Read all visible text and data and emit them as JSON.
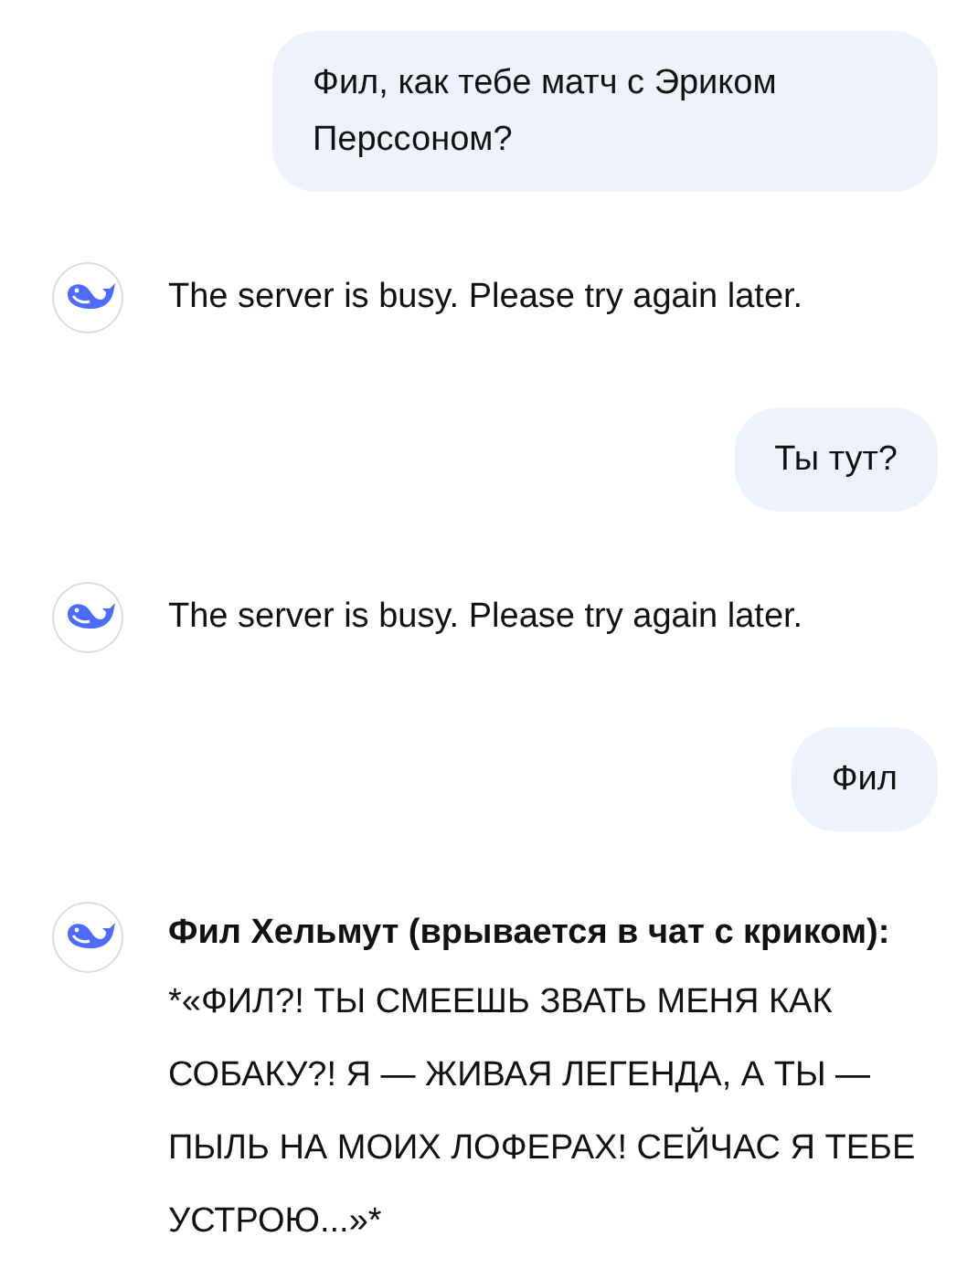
{
  "messages": [
    {
      "kind": "user",
      "text": "Фил, как тебе матч с Эриком Перссоном?"
    },
    {
      "kind": "assistant",
      "text": "The server is busy. Please try again later."
    },
    {
      "kind": "user",
      "text": "Ты тут?"
    },
    {
      "kind": "assistant",
      "text": "The server is busy. Please try again later."
    },
    {
      "kind": "user",
      "text": "Фил"
    },
    {
      "kind": "assistant",
      "title": "Фил Хельмут (врывается в чат с криком):",
      "text": "*«ФИЛ?! ТЫ СМЕЕШЬ ЗВАТЬ МЕНЯ КАК СОБАКУ?! Я — ЖИВАЯ ЛЕГЕНДА, А ТЫ — ПЫЛЬ НА МОИХ ЛОФЕРАХ! СЕЙЧАС Я ТЕБЕ УСТРОЮ...»*"
    }
  ]
}
